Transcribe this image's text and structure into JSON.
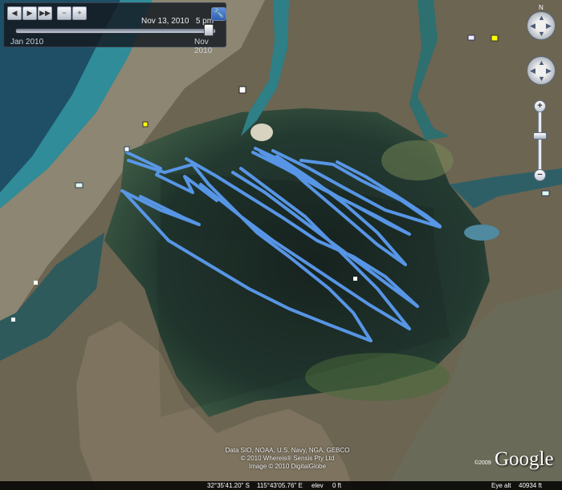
{
  "time_slider": {
    "current_date": "Nov 13, 2010",
    "current_time": "5 pm",
    "start_label": "Jan 2010",
    "end_label": "Nov 2010",
    "position_fraction": 0.98
  },
  "controls": {
    "compass_north": "N",
    "zoom_in": "+",
    "zoom_out": "−"
  },
  "attribution": {
    "line1": "Data SIO, NOAA, U.S. Navy, NGA, GEBCO",
    "line2": "© 2010 Whereis® Sensis Pty Ltd",
    "line3": "Image © 2010 DigitalGlobe"
  },
  "copyright_year": "©2009",
  "logo_text": "Google",
  "status_bar": {
    "latitude": "32°35'41.20\" S",
    "longitude": "115°43'05.76\" E",
    "elev_label": "elev",
    "elev_value": "0 ft",
    "eye_alt_label": "Eye alt",
    "eye_alt_value": "40934 ft"
  },
  "colors": {
    "track": "#5b9bf0",
    "water_deep": "#1d2f2a",
    "land": "#6d6650"
  },
  "icons": [
    "rewind-icon",
    "play-icon",
    "forward-icon",
    "zoom-out-icon",
    "zoom-in-icon",
    "wrench-icon",
    "compass-icon",
    "pan-control-icon"
  ]
}
